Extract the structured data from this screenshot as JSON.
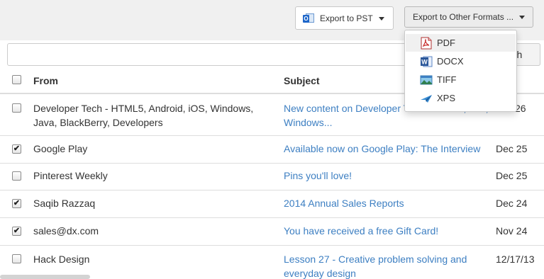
{
  "toolbar": {
    "export_pst_label": "Export to PST",
    "export_other_label": "Export to Other Formats ...",
    "outlook_icon_letter": "O"
  },
  "search": {
    "placeholder": "",
    "button_label": "arch"
  },
  "dropdown": {
    "items": [
      {
        "label": "PDF",
        "icon": "pdf-icon"
      },
      {
        "label": "DOCX",
        "icon": "word-icon",
        "icon_letter": "W"
      },
      {
        "label": "TIFF",
        "icon": "image-icon"
      },
      {
        "label": "XPS",
        "icon": "xps-icon"
      }
    ]
  },
  "table": {
    "headers": {
      "from": "From",
      "subject": "Subject"
    },
    "rows": [
      {
        "checked": false,
        "from": "Developer Tech - HTML5, Android, iOS, Windows, Java, BlackBerry, Developers",
        "subject": "New content on Developer Tech: Android, iOS, Windows...",
        "date": "26"
      },
      {
        "checked": true,
        "from": "Google Play",
        "subject": "Available now on Google Play: The Interview",
        "date": "Dec 25"
      },
      {
        "checked": false,
        "from": "Pinterest Weekly",
        "subject": "Pins you'll love!",
        "date": "Dec 25"
      },
      {
        "checked": true,
        "from": "Saqib Razzaq",
        "subject": "2014 Annual Sales Reports",
        "date": "Dec 24"
      },
      {
        "checked": true,
        "from": "sales@dx.com",
        "subject": "You have received a free Gift Card!",
        "date": "Nov 24"
      },
      {
        "checked": false,
        "from": "Hack Design",
        "subject": "Lesson 27 - Creative problem solving and everyday design",
        "date": "12/17/13"
      }
    ]
  },
  "checkmark_glyph": "✔",
  "colors": {
    "link": "#3d7fc2",
    "toolbar_bg": "#f0f0f0"
  }
}
